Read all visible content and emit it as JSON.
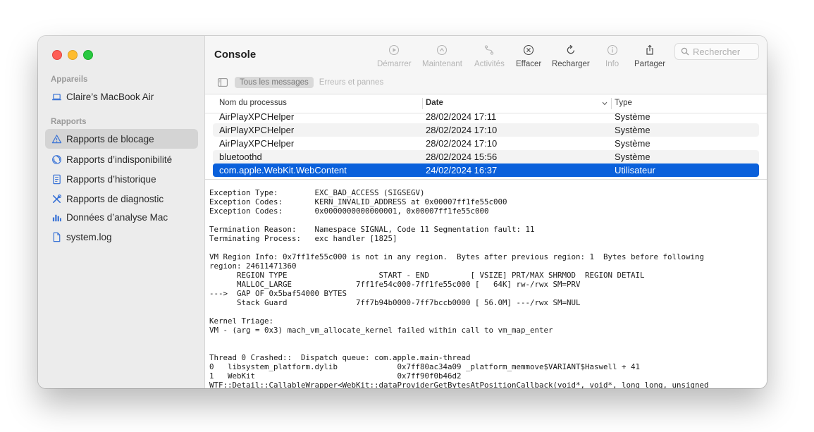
{
  "sidebar": {
    "devices_label": "Appareils",
    "device_name": "Claire’s MacBook Air",
    "reports_label": "Rapports",
    "items": [
      {
        "label": "Rapports de blocage",
        "icon": "warning-triangle-icon"
      },
      {
        "label": "Rapports d’indisponibilité",
        "icon": "hang-report-icon"
      },
      {
        "label": "Rapports d’historique",
        "icon": "document-icon"
      },
      {
        "label": "Rapports de diagnostic",
        "icon": "tools-icon"
      },
      {
        "label": "Données d’analyse Mac",
        "icon": "chart-icon"
      },
      {
        "label": "system.log",
        "icon": "file-icon"
      }
    ]
  },
  "toolbar": {
    "title": "Console",
    "buttons": [
      {
        "label": "Démarrer",
        "icon": "play-icon",
        "enabled": false
      },
      {
        "label": "Maintenant",
        "icon": "now-icon",
        "enabled": false
      },
      {
        "label": "Activités",
        "icon": "activities-icon",
        "enabled": false
      },
      {
        "label": "Effacer",
        "icon": "clear-icon",
        "enabled": true
      },
      {
        "label": "Recharger",
        "icon": "reload-icon",
        "enabled": true
      },
      {
        "label": "Info",
        "icon": "info-icon",
        "enabled": false
      },
      {
        "label": "Partager",
        "icon": "share-icon",
        "enabled": true
      }
    ],
    "search_placeholder": "Rechercher"
  },
  "filters": {
    "all_messages": "Tous les messages",
    "errors": "Erreurs et pannes"
  },
  "table": {
    "headers": [
      "Nom du processus",
      "Date",
      "Type"
    ],
    "rows": [
      {
        "process": "AirPlayXPCHelper",
        "date": "28/02/2024 17:11",
        "type": "Système"
      },
      {
        "process": "AirPlayXPCHelper",
        "date": "28/02/2024 17:10",
        "type": "Système"
      },
      {
        "process": "AirPlayXPCHelper",
        "date": "28/02/2024 17:10",
        "type": "Système"
      },
      {
        "process": "bluetoothd",
        "date": "28/02/2024 15:56",
        "type": "Système"
      },
      {
        "process": "com.apple.WebKit.WebContent",
        "date": "24/02/2024 16:37",
        "type": "Utilisateur"
      }
    ]
  },
  "log_lines": [
    "Exception Type:        EXC_BAD_ACCESS (SIGSEGV)",
    "Exception Codes:       KERN_INVALID_ADDRESS at 0x00007ff1fe55c000",
    "Exception Codes:       0x0000000000000001, 0x00007ff1fe55c000",
    "",
    "Termination Reason:    Namespace SIGNAL, Code 11 Segmentation fault: 11",
    "Terminating Process:   exc handler [1825]",
    "",
    "VM Region Info: 0x7ff1fe55c000 is not in any region.  Bytes after previous region: 1  Bytes before following",
    "region: 24611471360",
    "      REGION TYPE                    START - END         [ VSIZE] PRT/MAX SHRMOD  REGION DETAIL",
    "      MALLOC_LARGE              7ff1fe54c000-7ff1fe55c000 [   64K] rw-/rwx SM=PRV",
    "--->  GAP OF 0x5baf54000 BYTES",
    "      Stack Guard               7ff7b94b0000-7ff7bccb0000 [ 56.0M] ---/rwx SM=NUL",
    "",
    "Kernel Triage:",
    "VM - (arg = 0x3) mach_vm_allocate_kernel failed within call to vm_map_enter",
    "",
    "",
    "Thread 0 Crashed::  Dispatch queue: com.apple.main-thread",
    "0   libsystem_platform.dylib             0x7ff80ac34a09 _platform_memmove$VARIANT$Haswell + 41",
    "1   WebKit                               0x7ff90f0b46d2",
    "WTF::Detail::CallableWrapper<WebKit::dataProviderGetBytesAtPositionCallback(void*, void*, long long, unsigned"
  ],
  "colors": {
    "selection": "#0a60db",
    "sidebar_bg": "#ececec",
    "sidebar_selected": "#d4d4d4"
  }
}
